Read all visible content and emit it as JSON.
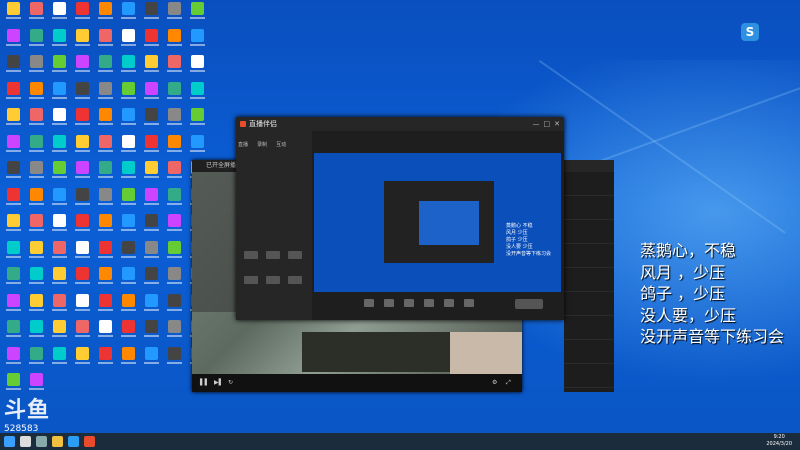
{
  "overlay_text": [
    "蒸鹅心，不稳",
    "风月  ，少压",
    "鸽子  ，少压",
    "没人要，少压",
    "没开声音等下练习会"
  ],
  "channel_logo": {
    "brand": "斗鱼",
    "room": "528583"
  },
  "app": {
    "title": "直播伴侣",
    "tabs": [
      "直播",
      "录制",
      "互动"
    ]
  },
  "player": {
    "title": "已开全屏播"
  },
  "preview_text": [
    "蒸鹅心  不稳",
    "风月    少压",
    "鸽子    少压",
    "没人要  少压",
    "没开声音等下练习会"
  ],
  "taskbar": {
    "time": "9:20",
    "date": "2024/3/20"
  },
  "colors": {
    "desktop": "#0b5fd6",
    "accent": "#e94b2d",
    "taskbar": "#1b2c3d"
  }
}
